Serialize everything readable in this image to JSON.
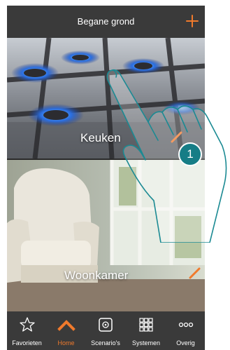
{
  "header": {
    "title": "Begane grond"
  },
  "rooms": [
    {
      "name": "Keuken"
    },
    {
      "name": "Woonkamer"
    }
  ],
  "nav": [
    {
      "label": "Favorieten",
      "icon": "star-icon"
    },
    {
      "label": "Home",
      "icon": "home-icon",
      "active": true
    },
    {
      "label": "Scenario's",
      "icon": "scenario-icon"
    },
    {
      "label": "Systemen",
      "icon": "grid-icon"
    },
    {
      "label": "Overig",
      "icon": "more-icon"
    }
  ],
  "callout": {
    "step": "1"
  },
  "colors": {
    "accent": "#f07a2c",
    "callout": "#167d86",
    "bar": "#3a3a3a"
  }
}
